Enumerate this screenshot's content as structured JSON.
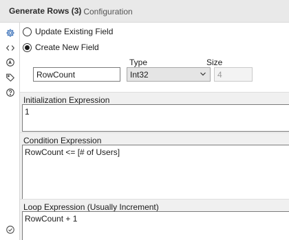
{
  "titlebar": {
    "tool_name": "Generate Rows (3)",
    "subtitle": "- Configuration"
  },
  "sidebar": {
    "icons": [
      "gear-icon",
      "code-icon",
      "connection-icon",
      "tag-icon",
      "help-icon"
    ],
    "bottom_icon": "check-circle-icon",
    "accent": "#3c72b9"
  },
  "mode": {
    "update_existing_label": "Update Existing Field",
    "create_new_label": "Create New  Field",
    "selected": "create_new"
  },
  "field": {
    "type_label": "Type",
    "size_label": "Size",
    "name_value": "RowCount",
    "type_value": "Int32",
    "size_value": "4"
  },
  "expressions": {
    "init_label": "Initialization Expression",
    "init_value": "1",
    "condition_label": "Condition Expression",
    "condition_value": "RowCount <= [# of Users]",
    "loop_label": "Loop Expression (Usually Increment)",
    "loop_value": "RowCount + 1"
  }
}
